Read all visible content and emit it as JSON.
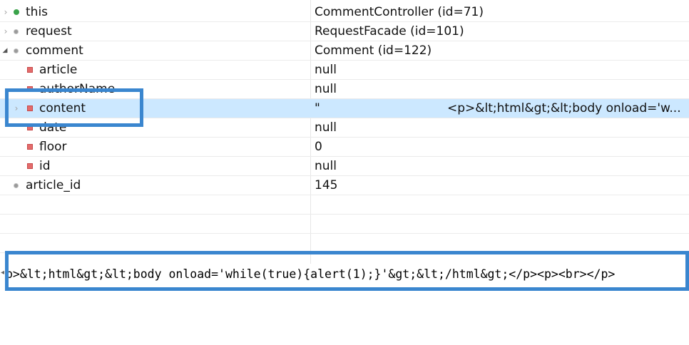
{
  "variables": [
    {
      "name": "this",
      "value": "CommentController  (id=71)",
      "icon": "field-public-icon",
      "expander": "›"
    },
    {
      "name": "request",
      "value": "RequestFacade  (id=101)",
      "icon": "field-default-icon",
      "expander": "›"
    },
    {
      "name": "comment",
      "value": "Comment  (id=122)",
      "icon": "field-default-icon",
      "expander": "◢"
    },
    {
      "name": "article",
      "value": "null",
      "icon": "field-private-icon",
      "expander": ""
    },
    {
      "name": "authorName",
      "value": "null",
      "icon": "field-private-icon",
      "expander": ""
    },
    {
      "name": "content",
      "value": "\"",
      "value_tail": "<p>&lt;html&gt;&lt;body onload='w...",
      "icon": "field-private-icon",
      "expander": "›",
      "selected": true
    },
    {
      "name": "date",
      "value": "null",
      "icon": "field-private-icon",
      "expander": ""
    },
    {
      "name": "floor",
      "value": "0",
      "icon": "field-private-icon",
      "expander": ""
    },
    {
      "name": "id",
      "value": "null",
      "icon": "field-private-icon",
      "expander": ""
    },
    {
      "name": "article_id",
      "value": "145",
      "icon": "field-default-icon",
      "expander": ""
    }
  ],
  "detail": {
    "text": "p>&lt;html&gt;&lt;body onload='while(true){alert(1);}'&gt;&lt;/html&gt;</p><p><br></p>",
    "left_marker": "◂"
  },
  "colors": {
    "selection": "#cce8ff",
    "highlight_border": "#3a86cf"
  }
}
